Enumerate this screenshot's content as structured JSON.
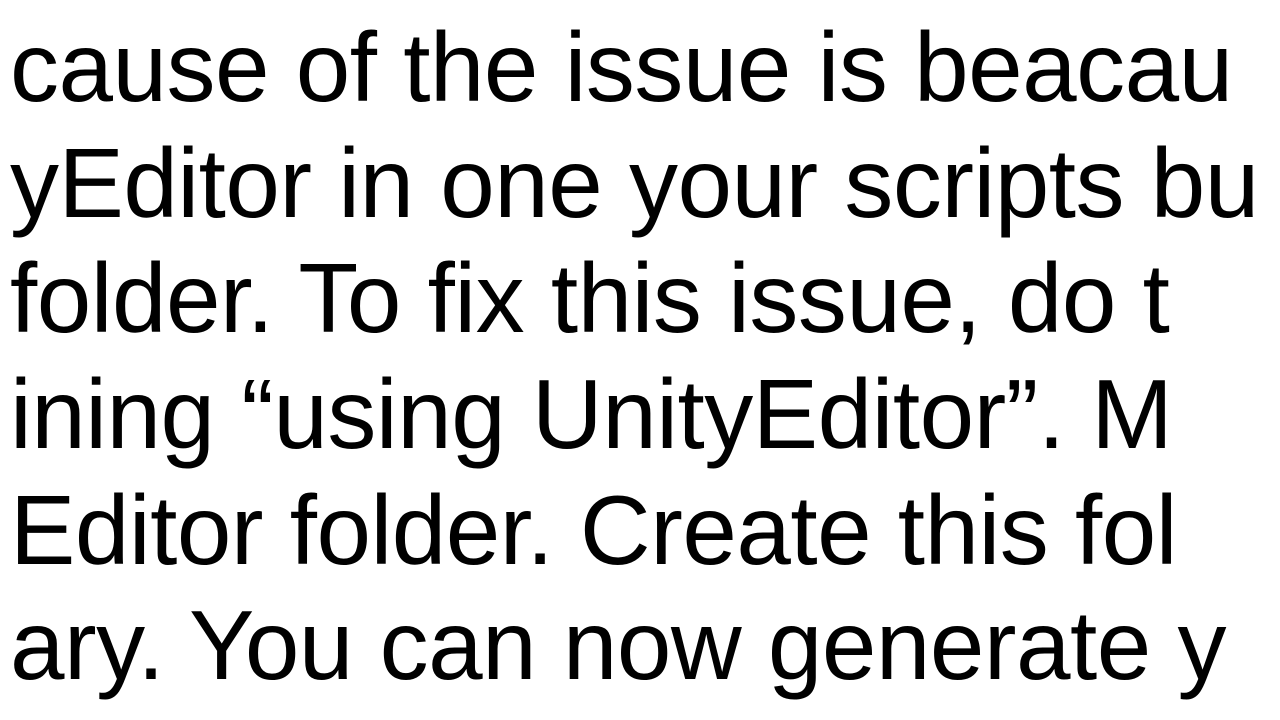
{
  "text": {
    "line1": "cause of the issue is beacau",
    "line2": "yEditor in one your scripts bu",
    "line3": " folder. To fix this issue, do t",
    "line4": "ining “using UnityEditor”. M",
    "line5": "Editor folder. Create this fol",
    "line6": "ary. You can now generate y"
  },
  "layout": {
    "leftOffset": "10px",
    "topOffset": "10px"
  }
}
